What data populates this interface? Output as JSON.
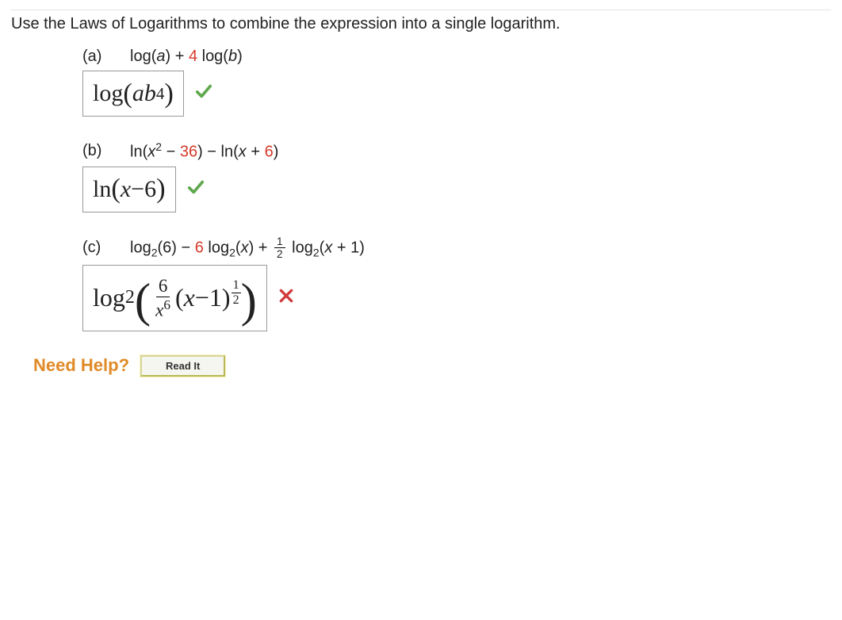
{
  "instruction": "Use the Laws of Logarithms to combine the expression into a single logarithm.",
  "parts": {
    "a": {
      "label": "(a)",
      "expr_pre": "log(",
      "expr_var1": "a",
      "expr_mid": ") + ",
      "expr_coeff": "4",
      "expr_mid2": " log(",
      "expr_var2": "b",
      "expr_post": ")",
      "answer_pre": "log",
      "answer_var1": "a",
      "answer_var2": "b",
      "answer_exp": "4",
      "status": "correct"
    },
    "b": {
      "label": "(b)",
      "expr_pre": "ln(",
      "expr_var": "x",
      "expr_exp": "2",
      "expr_mid1": " − ",
      "expr_const1": "36",
      "expr_mid2": ") − ln(",
      "expr_var2": "x",
      "expr_mid3": " + ",
      "expr_const2": "6",
      "expr_post": ")",
      "answer_pre": "ln",
      "answer_var": "x",
      "answer_op": " − ",
      "answer_const": "6",
      "status": "correct"
    },
    "c": {
      "label": "(c)",
      "expr_t1": "log",
      "expr_base": "2",
      "expr_arg1": "(6) − ",
      "expr_coeff2": "6",
      "expr_t2": " log",
      "expr_arg2_var": "x",
      "expr_arg2_post": ") + ",
      "expr_frac_num": "1",
      "expr_frac_den": "2",
      "expr_t3": " log",
      "expr_arg3_var": "x",
      "expr_arg3_post": " + 1)",
      "answer_pre": "log",
      "answer_base": "2",
      "answer_frac_num": "6",
      "answer_frac_den_var": "x",
      "answer_frac_den_exp": "6",
      "answer_inner_var": "x",
      "answer_inner_op": " − ",
      "answer_inner_const": "1",
      "answer_pow_num": "1",
      "answer_pow_den": "2",
      "status": "incorrect"
    }
  },
  "help": {
    "label": "Need Help?",
    "read_it": "Read It"
  },
  "icons": {
    "check": "check-icon",
    "x": "x-icon"
  }
}
